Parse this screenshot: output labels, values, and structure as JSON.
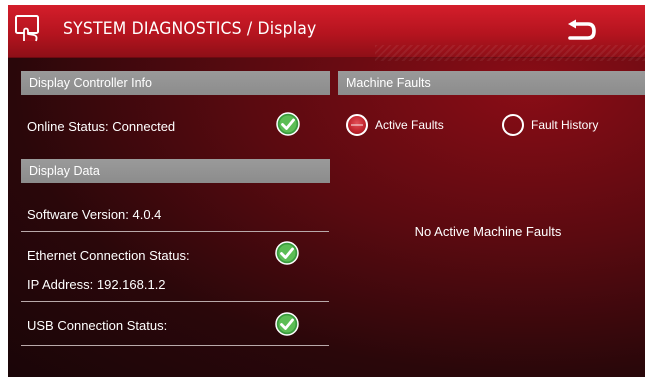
{
  "header": {
    "title": "SYSTEM DIAGNOSTICS / Display",
    "home_icon": "touch-screen-icon",
    "back_icon": "return-arrow-icon"
  },
  "left": {
    "controller_section": "Display Controller Info",
    "online_status": "Online Status: Connected",
    "display_data_section": "Display Data",
    "software_version": "Software Version: 4.0.4",
    "ethernet_status": "Ethernet Connection Status:",
    "ip_address": "IP Address: 192.168.1.2",
    "usb_status": "USB Connection Status:"
  },
  "right": {
    "faults_section": "Machine Faults",
    "active_faults": "Active Faults",
    "fault_history": "Fault History",
    "selected": "Active Faults",
    "empty_message": "No Active Machine Faults"
  },
  "colors": {
    "accent": "#c3262f",
    "check_green": "#4caf50",
    "section_gray": "#8c8c8c"
  }
}
